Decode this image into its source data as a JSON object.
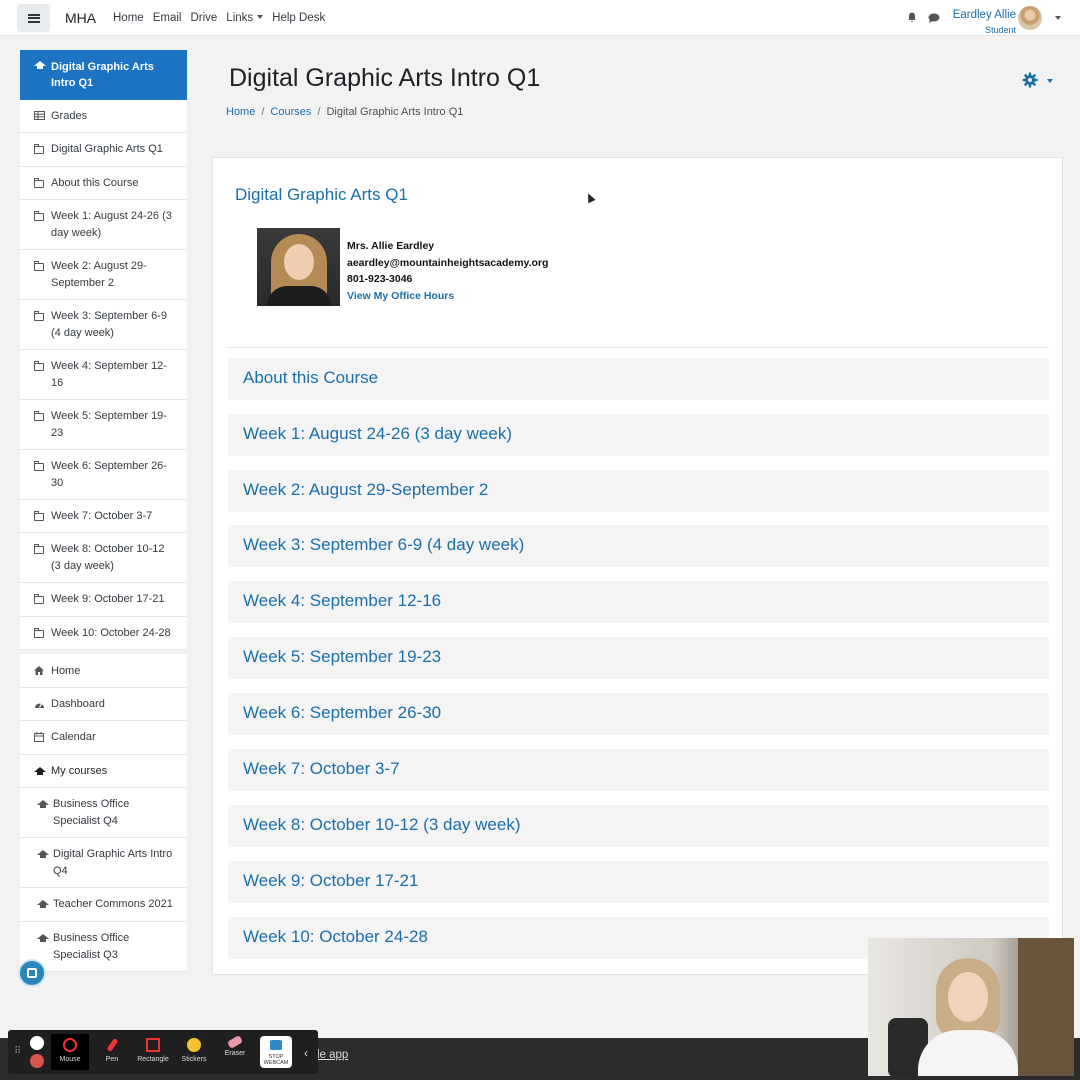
{
  "navbar": {
    "brand": "MHA",
    "links": [
      "Home",
      "Email",
      "Drive",
      "Links",
      "Help Desk"
    ],
    "user_name": "Eardley Allie",
    "user_role": "Student"
  },
  "drawer": {
    "active": "Digital Graphic Arts Intro Q1",
    "course_items": [
      "Grades",
      "Digital Graphic Arts Q1",
      "About this Course",
      "Week 1: August 24-26 (3 day week)",
      "Week 2: August 29-September 2",
      "Week 3: September 6-9 (4 day week)",
      "Week 4: September 12-16",
      "Week 5: September 19-23",
      "Week 6: September 26-30",
      "Week 7: October 3-7",
      "Week 8: October 10-12 (3 day week)",
      "Week 9: October 17-21",
      "Week 10: October 24-28"
    ],
    "site_items": [
      "Home",
      "Dashboard",
      "Calendar",
      "My courses"
    ],
    "my_courses": [
      "Business Office Specialist Q4",
      "Digital Graphic Arts Intro Q4",
      "Teacher Commons 2021",
      "Business Office Specialist Q3"
    ]
  },
  "page": {
    "title": "Digital Graphic Arts Intro Q1",
    "breadcrumb": [
      "Home",
      "Courses",
      "Digital Graphic Arts Intro Q1"
    ]
  },
  "course": {
    "name": "Digital Graphic Arts Q1",
    "teacher": "Mrs. Allie Eardley",
    "email": "aeardley@mountainheightsacademy.org",
    "phone": "801-923-3046",
    "office_hours_link": "View My Office Hours",
    "sections": [
      "About this Course",
      "Week 1: August 24-26 (3 day week)",
      "Week 2: August 29-September 2",
      "Week 3: September 6-9 (4 day week)",
      "Week 4: September 12-16",
      "Week 5: September 19-23",
      "Week 6: September 26-30",
      "Week 7: October 3-7",
      "Week 8: October 10-12 (3 day week)",
      "Week 9: October 17-21",
      "Week 10: October 24-28"
    ]
  },
  "recorder": {
    "tools": [
      "Mouse",
      "Pen",
      "Rectangle",
      "Stickers",
      "Eraser"
    ],
    "stop_webcam": "STOP WEBCAM",
    "strip_text": "le app"
  },
  "colors": {
    "accent": "#1b73c2",
    "link": "#1b6fa8"
  }
}
